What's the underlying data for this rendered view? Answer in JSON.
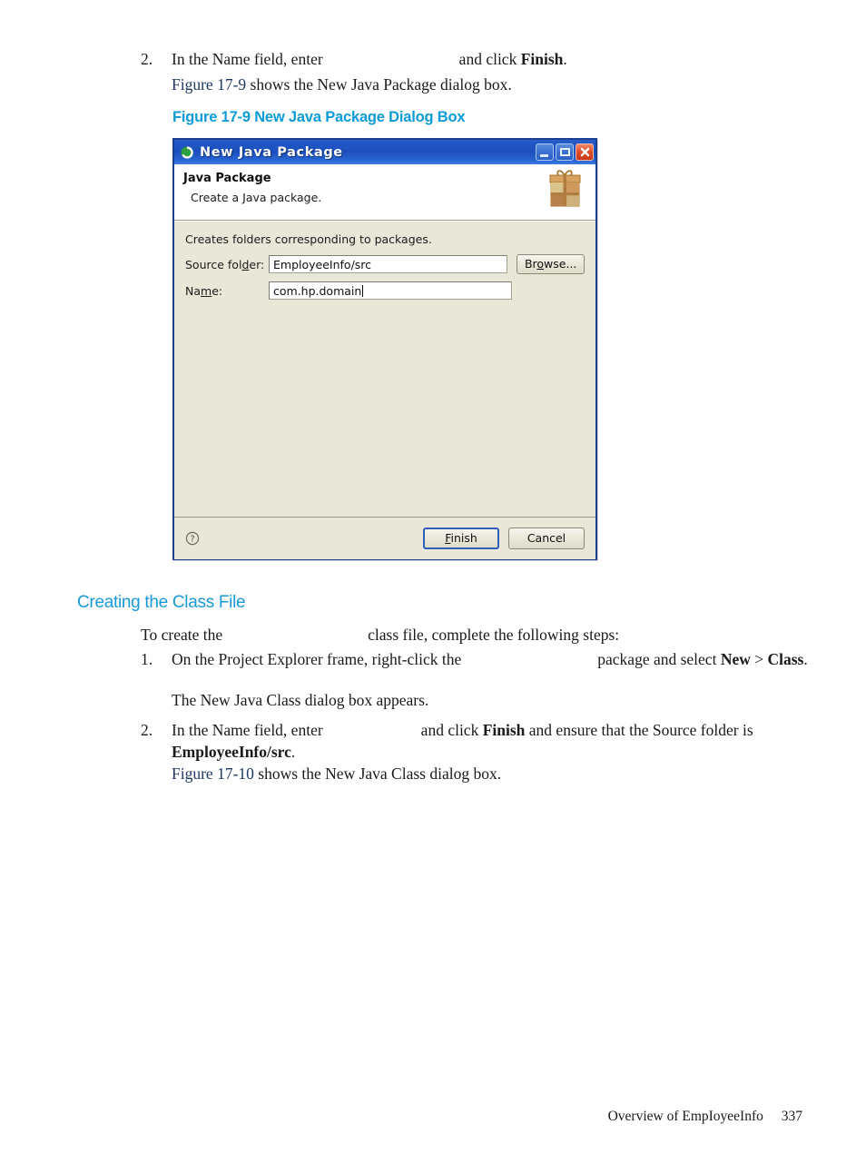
{
  "page": {
    "footer_text": "Overview of EmpIoyeeInfo",
    "page_number": "337"
  },
  "step_top": {
    "number": "2.",
    "text_before": "In the Name field, enter",
    "text_middle": "and click",
    "bold_term": "Finish",
    "text_after": ".",
    "followup_link": "Figure 17-9",
    "followup_rest": "shows the New Java Package dialog box."
  },
  "figure": {
    "caption": "Figure 17-9 New Java Package Dialog Box",
    "caption_color": "#0b9bd7"
  },
  "dialog": {
    "window_icon": "java-package-icon",
    "title": "New Java Package",
    "buttons": {
      "minimize": "minimize-button",
      "maximize": "maximize-button",
      "close": "close-button"
    },
    "header": {
      "title": "Java Package",
      "subtitle": "Create a Java package.",
      "icon": "gift-package-icon"
    },
    "body": {
      "hint": "Creates folders corresponding to packages.",
      "fields": [
        {
          "label_pre": "Source fol",
          "label_accel": "d",
          "label_post": "er:",
          "value": "EmployeeInfo/src",
          "has_caret": false
        },
        {
          "label_pre": "Na",
          "label_accel": "m",
          "label_post": "e:",
          "value": "com.hp.domain",
          "has_caret": true
        }
      ],
      "browse_label_pre": "Br",
      "browse_label_accel": "o",
      "browse_label_post": "wse..."
    },
    "footer": {
      "help_icon": "help-question-icon",
      "finish_pre": "",
      "finish_accel": "F",
      "finish_post": "inish",
      "cancel_label": "Cancel"
    },
    "colors": {
      "titlebar": "#1c4fbd",
      "body_bg": "#e9e7d8",
      "border": "#1c3f94",
      "close_button": "#c63818",
      "default_button_border": "#2f5fb8"
    }
  },
  "section": {
    "heading": "Creating the Class File",
    "heading_color": "#1999d5",
    "intro_before": "To create the",
    "intro_after": "class file, complete the following steps:",
    "steps": [
      {
        "number": "1.",
        "t1": "On the Project Explorer frame, right-click the",
        "t2": "package and select",
        "b1": "New",
        "t3": ">",
        "b2": "Class",
        "t4": ".",
        "note": "The New Java Class dialog box appears."
      },
      {
        "number": "2.",
        "t1": "In the Name field, enter",
        "t2": "and click",
        "b1": "Finish",
        "t3": "and ensure that the Source folder is",
        "b2": "EmployeeInfo/src",
        "t4": ".",
        "link": "Figure 17-10",
        "link_rest": "shows the New Java Class dialog box."
      }
    ]
  }
}
